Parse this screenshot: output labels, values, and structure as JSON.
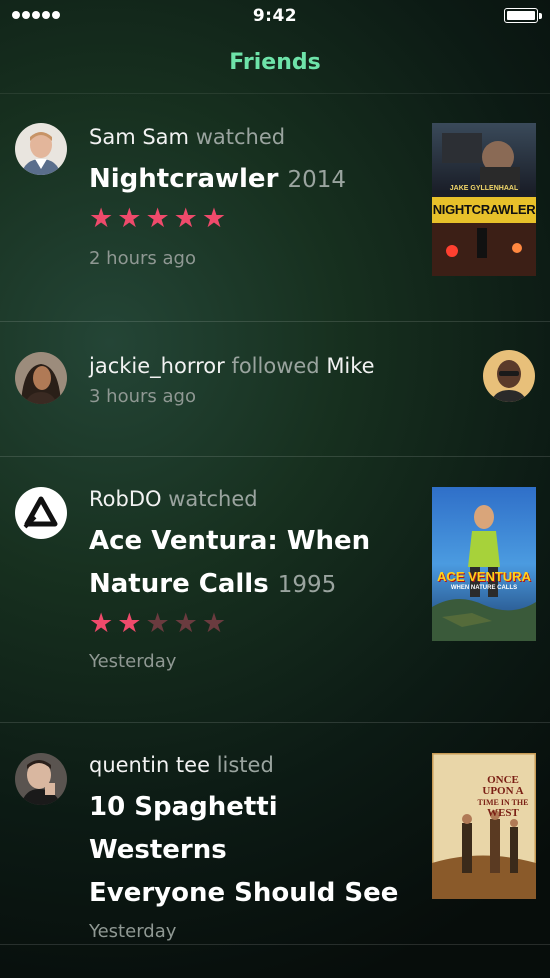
{
  "status_bar": {
    "time": "9:42"
  },
  "nav": {
    "title": "Friends"
  },
  "feed": [
    {
      "user": "Sam Sam",
      "verb": "watched",
      "title": "Nightcrawler",
      "year": "2014",
      "rating": 5,
      "time": "2 hours ago",
      "poster_title": "NIGHTCRAWLER",
      "poster_credit": "JAKE GYLLENHAAL"
    },
    {
      "user": "jackie_horror",
      "verb": "followed",
      "target": "Mike",
      "time": "3 hours ago"
    },
    {
      "user": "RobDO",
      "verb": "watched",
      "title_line1": "Ace Ventura: When",
      "title_line2": "Nature Calls",
      "year": "1995",
      "rating": 2,
      "time": "Yesterday",
      "poster_title": "ACE VENTURA",
      "poster_subtitle": "WHEN NATURE CALLS"
    },
    {
      "user": "quentin tee",
      "verb": "listed",
      "title_line1": "10 Spaghetti Westerns",
      "title_line2": "Everyone Should See",
      "time": "Yesterday",
      "poster_title_1": "ONCE",
      "poster_title_2": "UPON A",
      "poster_title_3": "TIME IN THE",
      "poster_title_4": "WEST"
    }
  ]
}
